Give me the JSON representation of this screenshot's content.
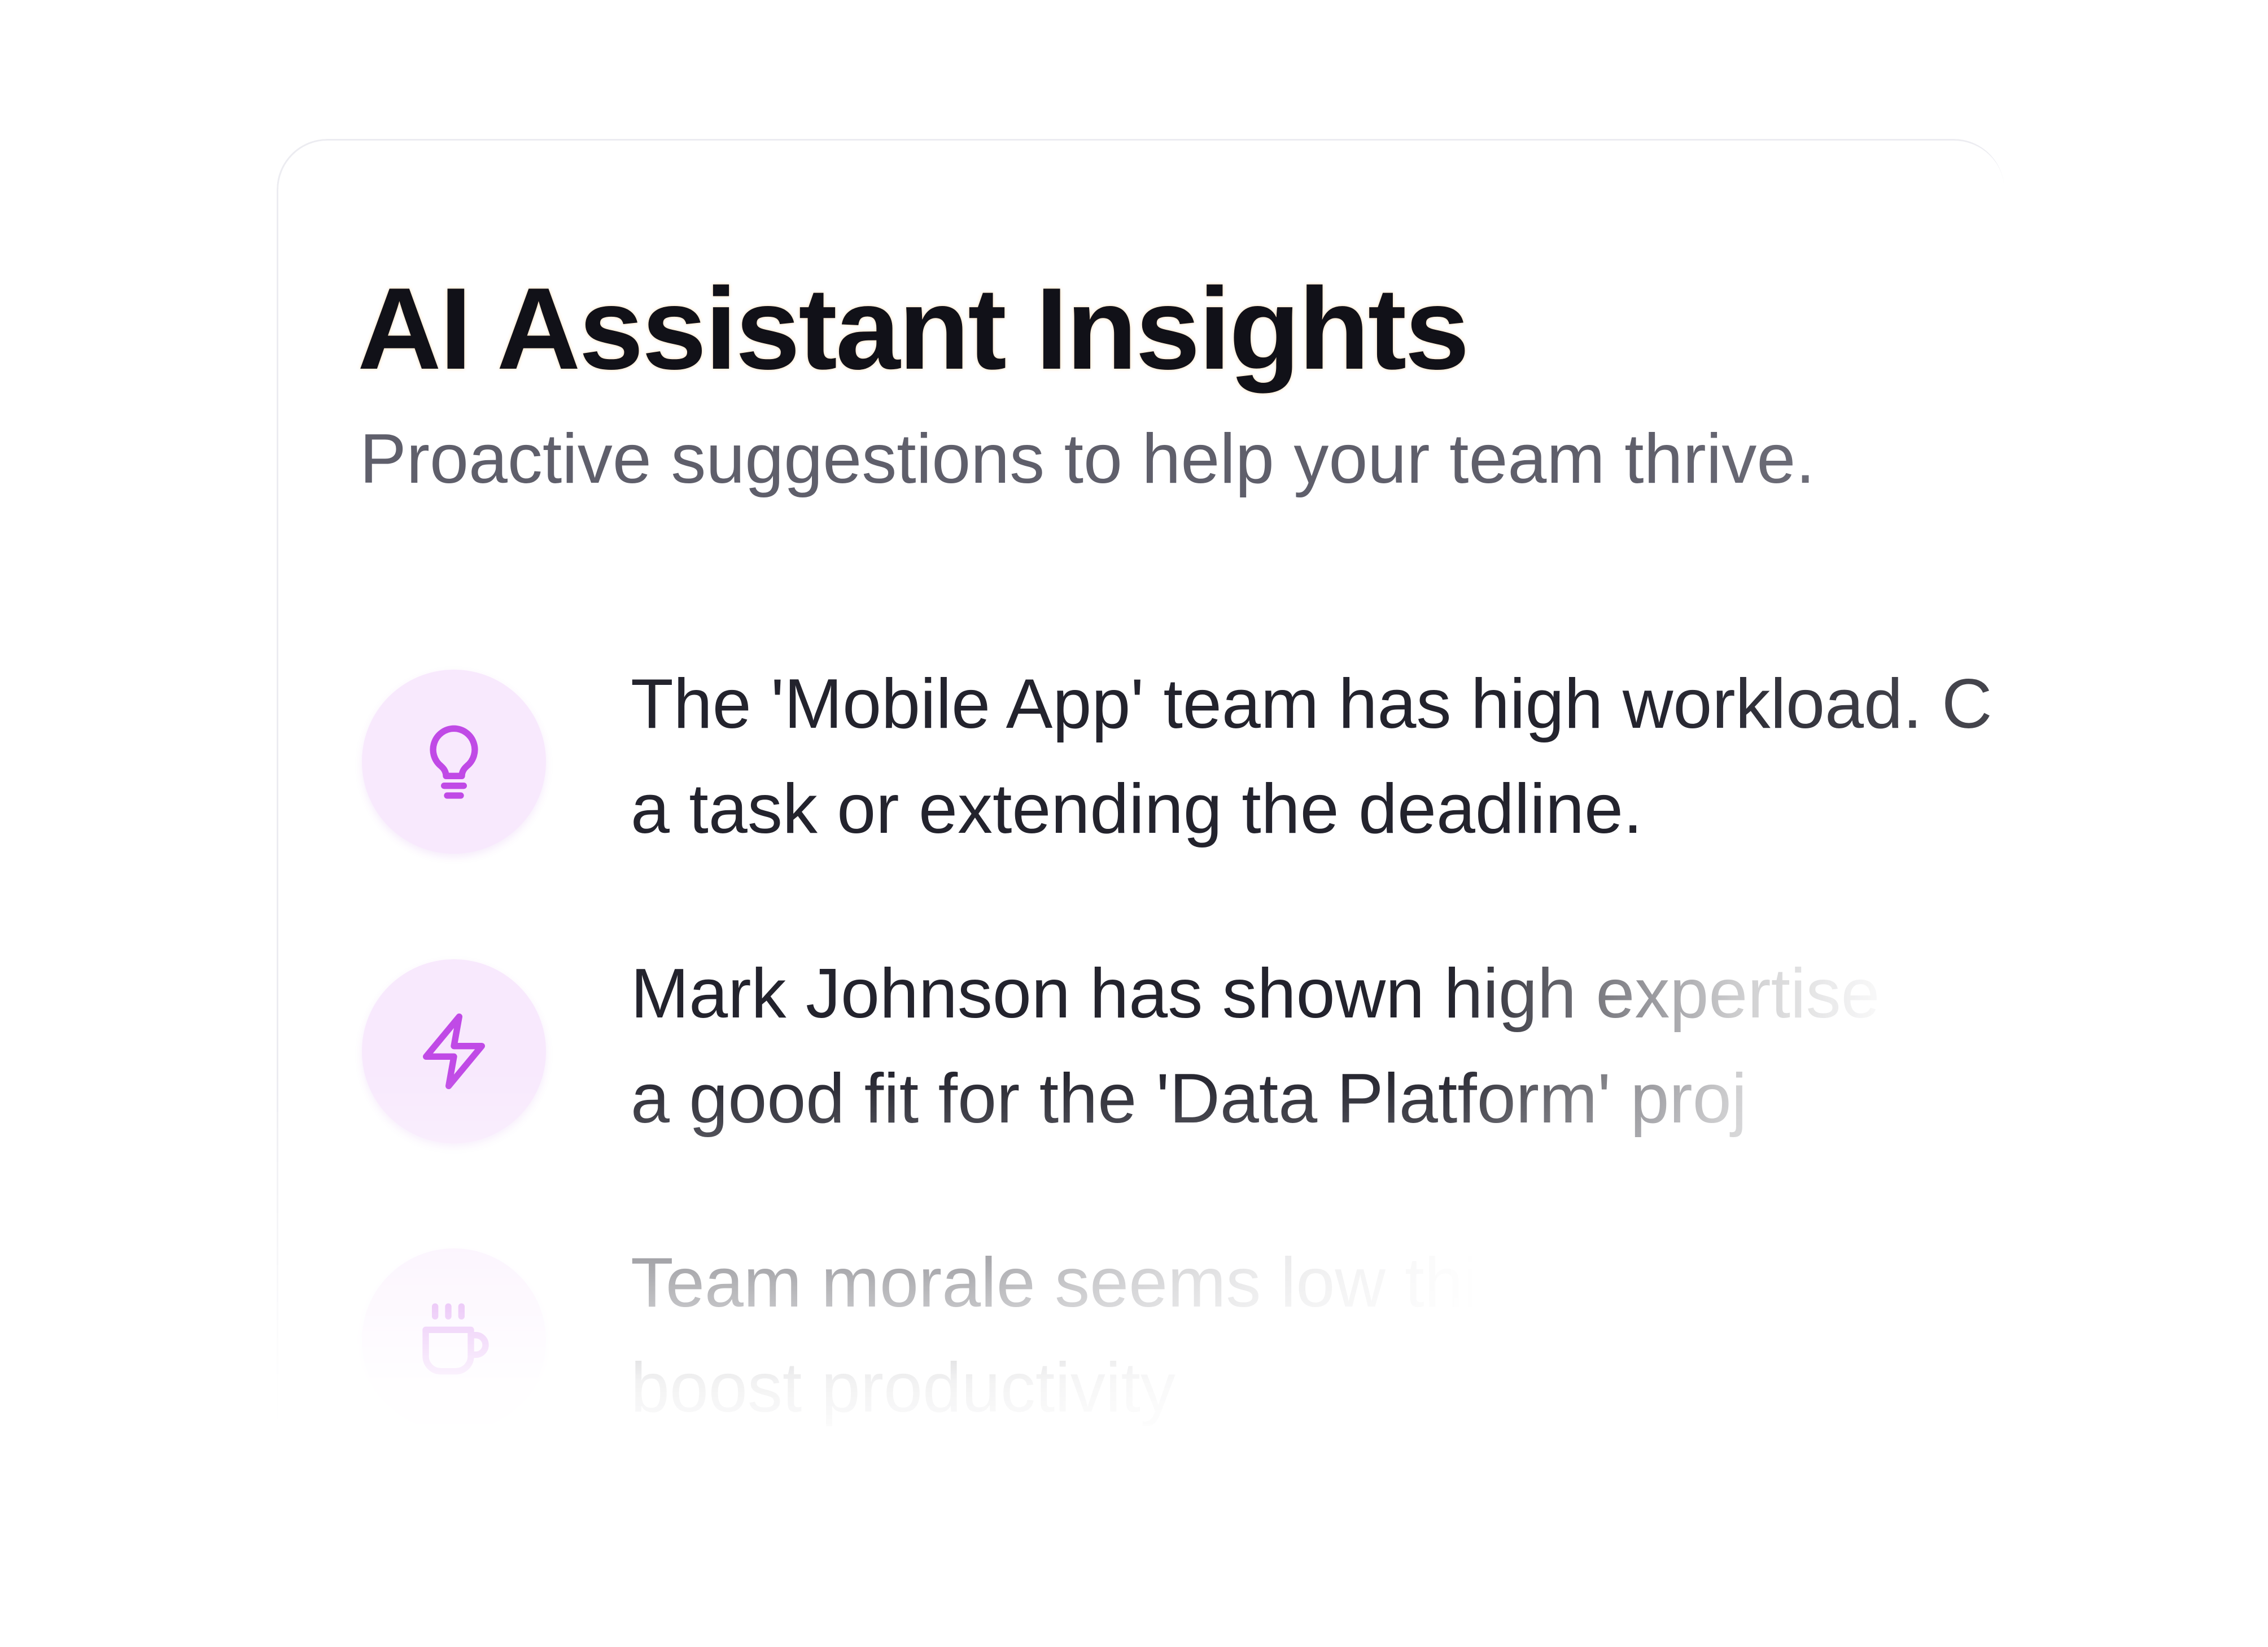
{
  "panel": {
    "title": "AI Assistant Insights",
    "subtitle": "Proactive suggestions to help your team thrive."
  },
  "insights": [
    {
      "icon": "lightbulb-icon",
      "line1": "The 'Mobile App' team has high workload. C",
      "line2": "a task or extending the deadline."
    },
    {
      "icon": "lightning-bolt-icon",
      "line1": "Mark Johnson has shown high expertise",
      "line2": "a good fit for the 'Data Platform' proj"
    },
    {
      "icon": "coffee-cup-icon",
      "line1": "Team morale seems low this w",
      "line2": "boost productivity"
    }
  ],
  "colors": {
    "accent": "#c04ae6",
    "icon_background": "#f8e9fd",
    "title": "#111118",
    "subtitle": "#5f5f6b",
    "body_text": "#23232d"
  }
}
